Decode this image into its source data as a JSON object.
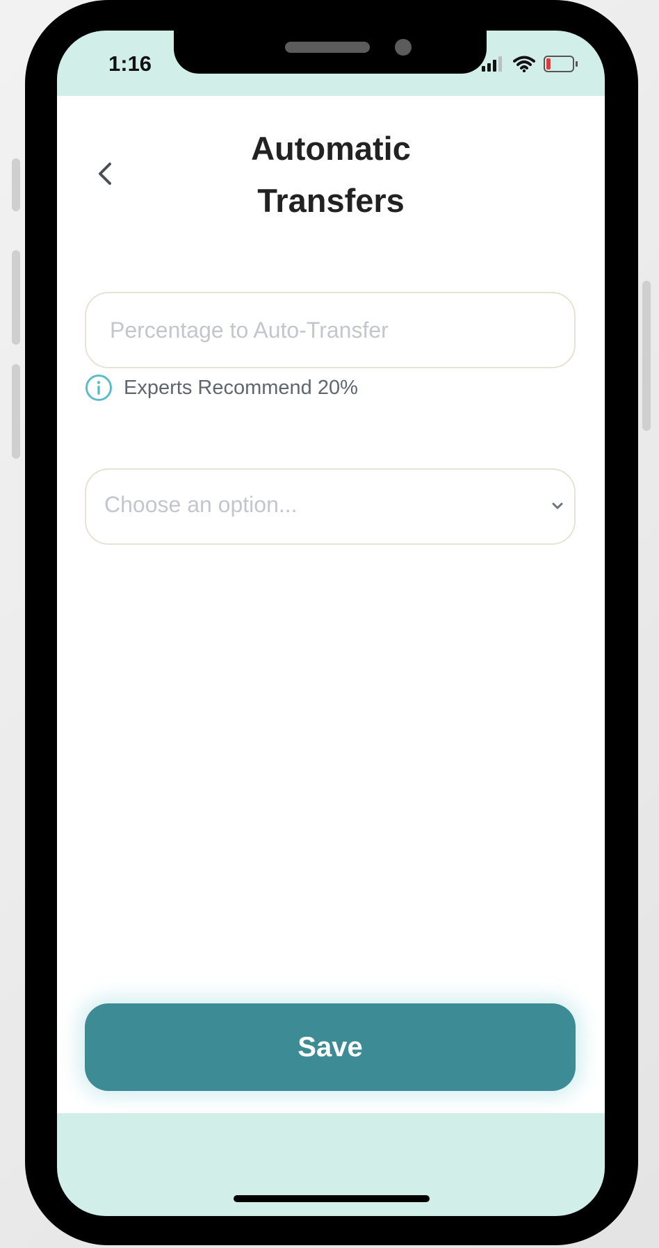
{
  "status_bar": {
    "time": "1:16"
  },
  "header": {
    "back_label": "‹",
    "title": "Automatic Transfers"
  },
  "form": {
    "percentage_placeholder": "Percentage to Auto-Transfer",
    "percentage_value": "",
    "hint": "Experts Recommend 20%",
    "select_placeholder": "Choose an option..."
  },
  "actions": {
    "save_label": "Save"
  },
  "colors": {
    "accent": "#3d8b95",
    "screen_bg": "#d2eee9",
    "info_icon": "#5bbcc8",
    "battery_low": "#e53935"
  },
  "icons": [
    "back-chevron-icon",
    "info-icon",
    "chevron-down-icon",
    "signal-icon",
    "wifi-icon",
    "battery-icon"
  ]
}
